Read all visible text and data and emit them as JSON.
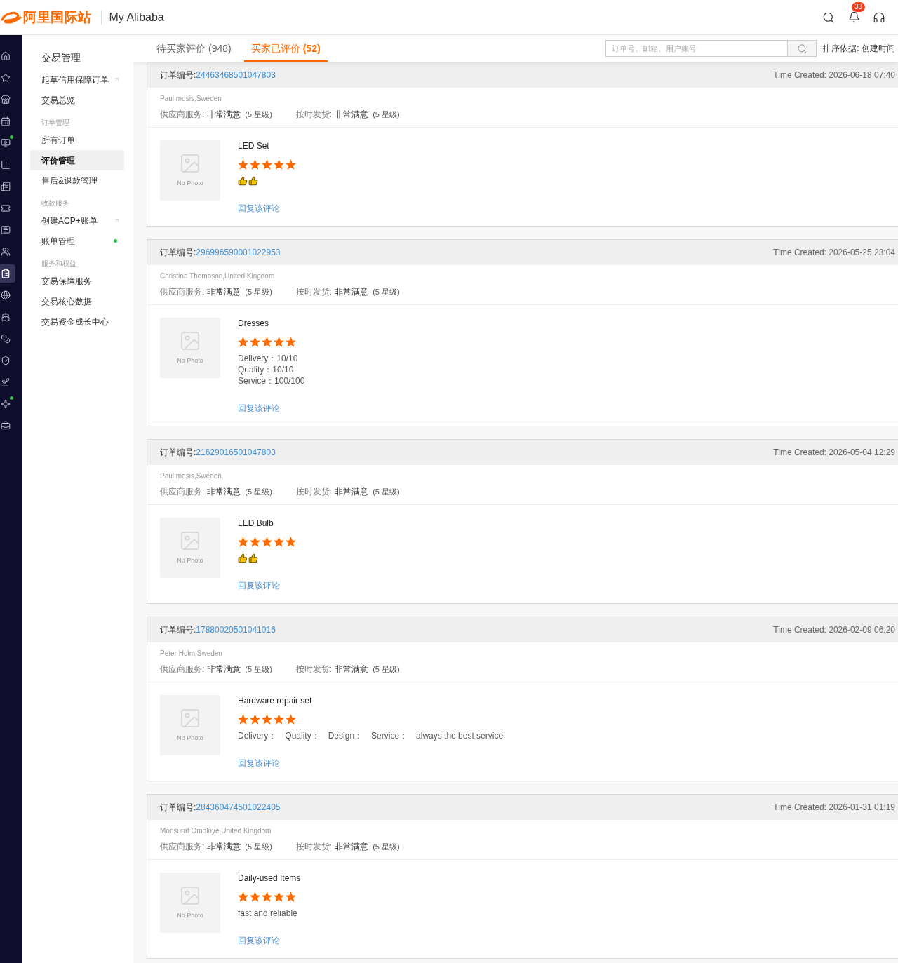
{
  "header": {
    "logo_text": "阿里国际站",
    "title": "My Alibaba",
    "notification_count": "33"
  },
  "rail": [
    {
      "selected": false,
      "dot": false
    },
    {
      "selected": false,
      "dot": false
    },
    {
      "selected": false,
      "dot": false
    },
    {
      "selected": false,
      "dot": false
    },
    {
      "selected": false,
      "dot": true
    },
    {
      "selected": false,
      "dot": false
    },
    {
      "selected": false,
      "dot": false
    },
    {
      "selected": false,
      "dot": false
    },
    {
      "selected": false,
      "dot": false
    },
    {
      "selected": false,
      "dot": false
    },
    {
      "selected": true,
      "dot": false
    },
    {
      "selected": false,
      "dot": false
    },
    {
      "selected": false,
      "dot": false
    },
    {
      "selected": false,
      "dot": false
    },
    {
      "selected": false,
      "dot": false
    },
    {
      "selected": false,
      "dot": false
    },
    {
      "selected": false,
      "dot": true
    },
    {
      "selected": false,
      "dot": false
    }
  ],
  "menu": [
    {
      "kind": "heading",
      "label": "交易管理"
    },
    {
      "kind": "item",
      "label": "起草信用保障订单",
      "selected": false,
      "external": true,
      "dot": false
    },
    {
      "kind": "item",
      "label": "交易总览",
      "selected": false,
      "external": false,
      "dot": false
    },
    {
      "kind": "section",
      "label": "订单管理"
    },
    {
      "kind": "item",
      "label": "所有订单",
      "selected": false,
      "external": false,
      "dot": false
    },
    {
      "kind": "item",
      "label": "评价管理",
      "selected": true,
      "external": false,
      "dot": false
    },
    {
      "kind": "item",
      "label": "售后&退款管理",
      "selected": false,
      "external": false,
      "dot": false
    },
    {
      "kind": "section",
      "label": "收款服务"
    },
    {
      "kind": "item",
      "label": "创建ACP+账单",
      "selected": false,
      "external": true,
      "dot": false
    },
    {
      "kind": "item",
      "label": "账单管理",
      "selected": false,
      "external": false,
      "dot": true
    },
    {
      "kind": "section",
      "label": "服务和权益"
    },
    {
      "kind": "item",
      "label": "交易保障服务",
      "selected": false,
      "external": false,
      "dot": false
    },
    {
      "kind": "item",
      "label": "交易核心数据",
      "selected": false,
      "external": false,
      "dot": false
    },
    {
      "kind": "item",
      "label": "交易资金成长中心",
      "selected": false,
      "external": false,
      "dot": false
    }
  ],
  "tabs": [
    {
      "label": "待买家评价",
      "count": "(948)",
      "selected": false
    },
    {
      "label": "买家已评价",
      "count": "(52)",
      "selected": true
    }
  ],
  "search": {
    "placeholder": "订单号、邮箱、用户账号"
  },
  "sort": "排序依据: 创建时间",
  "reviews": [
    {
      "order_label": "订单编号:",
      "order_no": "24463468501047803",
      "time": "Time Created: 2026-06-18 07:40",
      "buyer": "Paul mosis,Sweden",
      "ratings": [
        {
          "label": "供应商服务:",
          "value": "非常满意",
          "grade": "(5 星级)"
        },
        {
          "label": "按时发货:",
          "value": "非常满意",
          "grade": "(5 星级)"
        }
      ],
      "photo_text": "No Photo",
      "product": "LED Set",
      "stars": 5,
      "comment": {
        "kind": "emoji",
        "items": [
          {
            "kind": "thumbs_up"
          },
          {
            "kind": "thumbs_up"
          }
        ]
      },
      "reply": "回复该评论"
    },
    {
      "order_label": "订单编号:",
      "order_no": "296996590001022953",
      "time": "Time Created: 2026-05-25 23:04",
      "buyer": "Christina Thompson,United Kingdom",
      "ratings": [
        {
          "label": "供应商服务:",
          "value": "非常满意",
          "grade": "(5 星级)"
        },
        {
          "label": "按时发货:",
          "value": "非常满意",
          "grade": "(5 星级)"
        }
      ],
      "photo_text": "No Photo",
      "product": "Dresses",
      "stars": 5,
      "comment": {
        "kind": "lines",
        "items": [
          "Delivery：10/10",
          "Quality：10/10",
          "Service：100/100"
        ]
      },
      "reply": "回复该评论"
    },
    {
      "order_label": "订单编号:",
      "order_no": "21629016501047803",
      "time": "Time Created: 2026-05-04 12:29",
      "buyer": "Paul mosis,Sweden",
      "ratings": [
        {
          "label": "供应商服务:",
          "value": "非常满意",
          "grade": "(5 星级)"
        },
        {
          "label": "按时发货:",
          "value": "非常满意",
          "grade": "(5 星级)"
        }
      ],
      "photo_text": "No Photo",
      "product": "LED Bulb",
      "stars": 5,
      "comment": {
        "kind": "emoji",
        "items": [
          {
            "kind": "thumbs_up"
          },
          {
            "kind": "thumbs_up"
          }
        ]
      },
      "reply": "回复该评论"
    },
    {
      "order_label": "订单编号:",
      "order_no": "17880020501041016",
      "time": "Time Created: 2026-02-09 06:20",
      "buyer": "Peter Holm,Sweden",
      "ratings": [
        {
          "label": "供应商服务:",
          "value": "非常满意",
          "grade": "(5 星级)"
        },
        {
          "label": "按时发货:",
          "value": "非常满意",
          "grade": "(5 星级)"
        }
      ],
      "photo_text": "No Photo",
      "product": "Hardware repair set",
      "stars": 5,
      "comment": {
        "kind": "row",
        "items": [
          "Delivery：",
          "Quality：",
          "Design：",
          "Service：",
          "always the best service"
        ]
      },
      "reply": "回复该评论"
    },
    {
      "order_label": "订单编号:",
      "order_no": "284360474501022405",
      "time": "Time Created: 2026-01-31 01:19",
      "buyer": "Monsurat Omoloye,United Kingdom",
      "ratings": [
        {
          "label": "供应商服务:",
          "value": "非常满意",
          "grade": "(5 星级)"
        },
        {
          "label": "按时发货:",
          "value": "非常满意",
          "grade": "(5 星级)"
        }
      ],
      "photo_text": "No Photo",
      "product": "Daily-used Items",
      "stars": 5,
      "comment": {
        "kind": "lines",
        "items": [
          "fast and reliable"
        ]
      },
      "reply": "回复该评论"
    }
  ]
}
